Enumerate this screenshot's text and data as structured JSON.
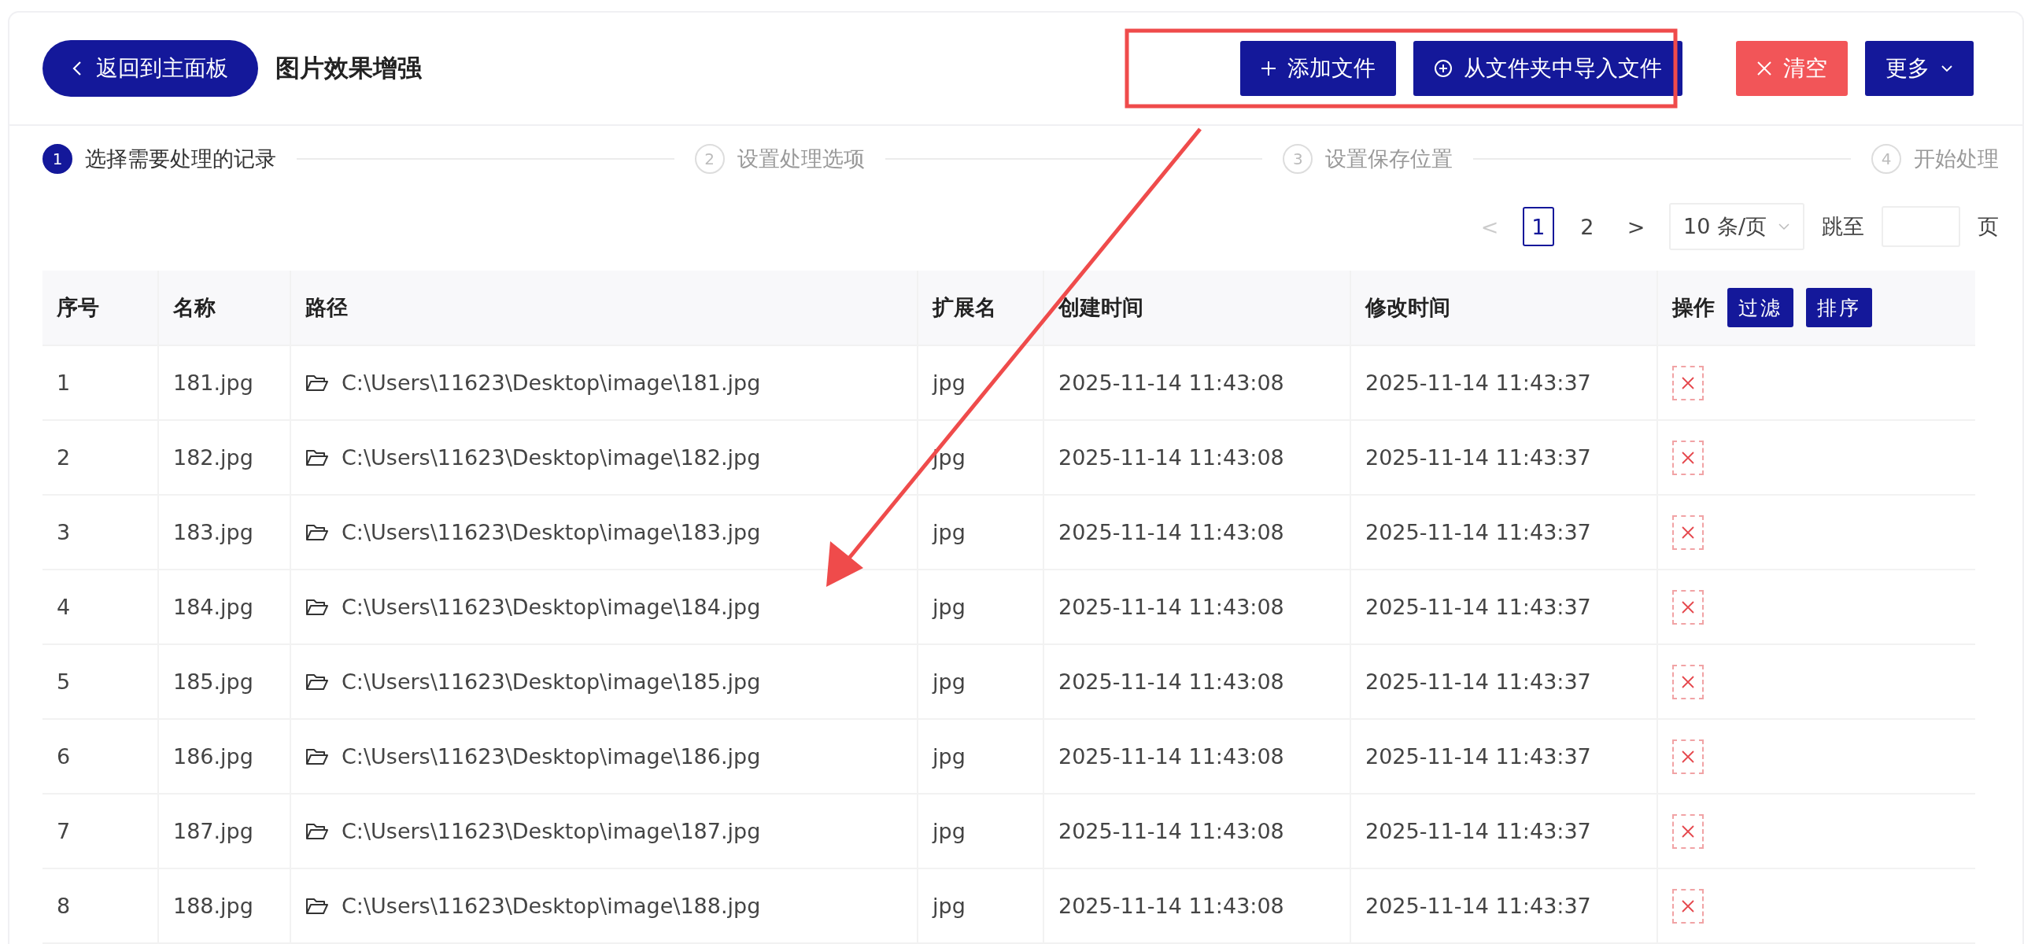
{
  "header": {
    "back_button": "返回到主面板",
    "title": "图片效果增强",
    "buttons": [
      {
        "label": "添加文件",
        "kind": "add"
      },
      {
        "label": "从文件夹中导入文件",
        "kind": "import"
      },
      {
        "label": "清空",
        "kind": "clear"
      },
      {
        "label": "更多",
        "kind": "more"
      }
    ]
  },
  "steps": [
    {
      "number": "1",
      "label": "选择需要处理的记录",
      "selected": true
    },
    {
      "number": "2",
      "label": "设置处理选项",
      "selected": false
    },
    {
      "number": "3",
      "label": "设置保存位置",
      "selected": false
    },
    {
      "number": "4",
      "label": "开始处理",
      "selected": false
    }
  ],
  "pagination": {
    "prev": "<",
    "pages": [
      {
        "label": "1",
        "selected": true
      },
      {
        "label": "2",
        "selected": false
      }
    ],
    "next": ">",
    "page_size": "10 条/页",
    "jump_label": "跳至",
    "page_unit": "页"
  },
  "table": {
    "columns": [
      "序号",
      "名称",
      "路径",
      "扩展名",
      "创建时间",
      "修改时间",
      "操作"
    ],
    "header_buttons": [
      "过滤",
      "排序"
    ],
    "rows": [
      {
        "index": "1",
        "name": "181.jpg",
        "path": "C:\\Users\\11623\\Desktop\\image\\181.jpg",
        "ext": "jpg",
        "created": "2025-11-14 11:43:08",
        "modified": "2025-11-14 11:43:37"
      },
      {
        "index": "2",
        "name": "182.jpg",
        "path": "C:\\Users\\11623\\Desktop\\image\\182.jpg",
        "ext": "jpg",
        "created": "2025-11-14 11:43:08",
        "modified": "2025-11-14 11:43:37"
      },
      {
        "index": "3",
        "name": "183.jpg",
        "path": "C:\\Users\\11623\\Desktop\\image\\183.jpg",
        "ext": "jpg",
        "created": "2025-11-14 11:43:08",
        "modified": "2025-11-14 11:43:37"
      },
      {
        "index": "4",
        "name": "184.jpg",
        "path": "C:\\Users\\11623\\Desktop\\image\\184.jpg",
        "ext": "jpg",
        "created": "2025-11-14 11:43:08",
        "modified": "2025-11-14 11:43:37"
      },
      {
        "index": "5",
        "name": "185.jpg",
        "path": "C:\\Users\\11623\\Desktop\\image\\185.jpg",
        "ext": "jpg",
        "created": "2025-11-14 11:43:08",
        "modified": "2025-11-14 11:43:37"
      },
      {
        "index": "6",
        "name": "186.jpg",
        "path": "C:\\Users\\11623\\Desktop\\image\\186.jpg",
        "ext": "jpg",
        "created": "2025-11-14 11:43:08",
        "modified": "2025-11-14 11:43:37"
      },
      {
        "index": "7",
        "name": "187.jpg",
        "path": "C:\\Users\\11623\\Desktop\\image\\187.jpg",
        "ext": "jpg",
        "created": "2025-11-14 11:43:08",
        "modified": "2025-11-14 11:43:37"
      },
      {
        "index": "8",
        "name": "188.jpg",
        "path": "C:\\Users\\11623\\Desktop\\image\\188.jpg",
        "ext": "jpg",
        "created": "2025-11-14 11:43:08",
        "modified": "2025-11-14 11:43:37"
      }
    ]
  }
}
